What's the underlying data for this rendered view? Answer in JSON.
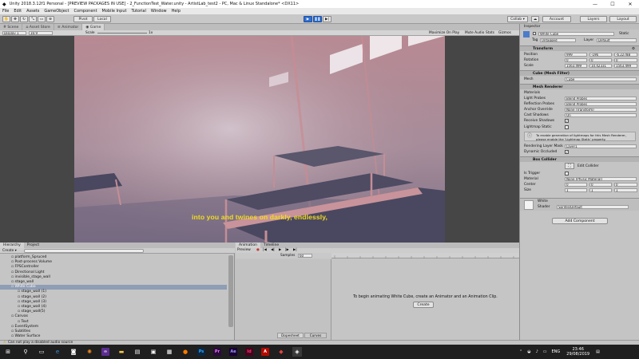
{
  "window": {
    "title": "Unity 2018.3.12f1 Personal - [PREVIEW PACKAGES IN USE] - 2_FunctionTest_Water.unity - ArtistLab_test2 - PC, Mac & Linux Standalone* <DX11>"
  },
  "menu": [
    "File",
    "Edit",
    "Assets",
    "GameObject",
    "Component",
    "Mobile Input",
    "Tutorial",
    "Window",
    "Help"
  ],
  "toolbar": {
    "pivot": "Pivot",
    "local": "Local",
    "collab": "Collab ▾",
    "account": "Account",
    "layers": "Layers",
    "layout": "Layout"
  },
  "tabs_top": [
    "Scene",
    "Asset Store",
    "Animator",
    "Game"
  ],
  "gamebar": {
    "display": "Display 1",
    "aspect": "16:9",
    "scale_label": "Scale",
    "scale_value": "1x",
    "maximize": "Maximize On Play",
    "mute": "Mute Audio",
    "stats": "Stats",
    "gizmos": "Gizmos"
  },
  "game": {
    "subtitle": "into you and twines on darkly, endlessly,"
  },
  "inspector": {
    "tab": "Inspector",
    "object_name": "White Cube",
    "static": "Static",
    "tag_label": "Tag",
    "tag_value": "Untagged",
    "layer_label": "Layer",
    "layer_value": "Default",
    "transform": "Transform",
    "position_label": "Position",
    "pos_x": "999",
    "pos_y": "-196",
    "pos_z": "-6.22788",
    "rotation_label": "Rotation",
    "rot_x": "0",
    "rot_y": "0",
    "rot_z": "0",
    "scale_label": "Scale",
    "scl_x": "1563.499",
    "scl_y": "10.42331",
    "scl_z": "1563.499",
    "mesh_filter": "Cube (Mesh Filter)",
    "mesh_label": "Mesh",
    "mesh_value": "Cube",
    "mesh_renderer": "Mesh Renderer",
    "materials": "Materials",
    "light_probes_label": "Light Probes",
    "light_probes_value": "Blend Probes",
    "reflection_label": "Reflection Probes",
    "reflection_value": "Blend Probes",
    "anchor_label": "Anchor Override",
    "anchor_value": "None (Transform)",
    "cast_label": "Cast Shadows",
    "cast_value": "On",
    "receive_label": "Receive Shadows",
    "lightmap_label": "Lightmap Static",
    "help_text": "To enable generation of lightmaps for this Mesh Renderer, please enable the 'Lightmap Static' property.",
    "render_layer_label": "Rendering Layer Mask",
    "render_layer_value": "Layer1",
    "dynamic_label": "Dynamic Occluded",
    "box_collider": "Box Collider",
    "edit_collider": "Edit Collider",
    "trigger_label": "Is Trigger",
    "material_label": "Material",
    "material_value": "None (Physic Material)",
    "center_label": "Center",
    "ctr_x": "0",
    "ctr_y": "0",
    "ctr_z": "0",
    "size_label": "Size",
    "sz_x": "1",
    "sz_y": "1",
    "sz_z": "1",
    "shader_name": "White",
    "shader_label": "Shader",
    "shader_value": "Sprites/Default",
    "add_component": "Add Component"
  },
  "hierarchy": {
    "tabs": [
      "Hierarchy",
      "Project"
    ],
    "create": "Create ▾",
    "items": [
      {
        "text": "platform_Spruced",
        "depth": 1
      },
      {
        "text": "Post-process Volume",
        "depth": 1
      },
      {
        "text": "FPSController",
        "depth": 1
      },
      {
        "text": "Directional Light",
        "depth": 1
      },
      {
        "text": "invisible_stage_wall",
        "depth": 1
      },
      {
        "text": "stage_wall",
        "depth": 1
      },
      {
        "text": "White Cube",
        "depth": 1,
        "selected": true
      },
      {
        "text": "stage_wall (1)",
        "depth": 2
      },
      {
        "text": "stage_wall (2)",
        "depth": 2
      },
      {
        "text": "stage_wall (3)",
        "depth": 2
      },
      {
        "text": "stage_wall (4)",
        "depth": 2
      },
      {
        "text": "stage_wall(5)",
        "depth": 2
      },
      {
        "text": "Canvas",
        "depth": 1
      },
      {
        "text": "Text",
        "depth": 2
      },
      {
        "text": "EventSystem",
        "depth": 1
      },
      {
        "text": "Subtitles",
        "depth": 1
      },
      {
        "text": "Water Surface",
        "depth": 1
      }
    ]
  },
  "animation": {
    "tabs": [
      "Animation",
      "Timeline"
    ],
    "preview": "Preview",
    "samples_label": "Samples",
    "samples_value": "60",
    "message": "To begin animating White Cube, create an Animator and an Animation Clip.",
    "create": "Create",
    "bottom_tabs": [
      "Dopesheet",
      "Curves"
    ]
  },
  "statusbar": {
    "text": "Can not play a disabled audio source"
  },
  "taskbar": {
    "lang": "ENG",
    "time": "23:46",
    "date": "29/08/2019"
  },
  "colors": {
    "accent": "#2f6fd1",
    "subtitle": "#f2dc1e",
    "selection": "#8f9db5"
  }
}
